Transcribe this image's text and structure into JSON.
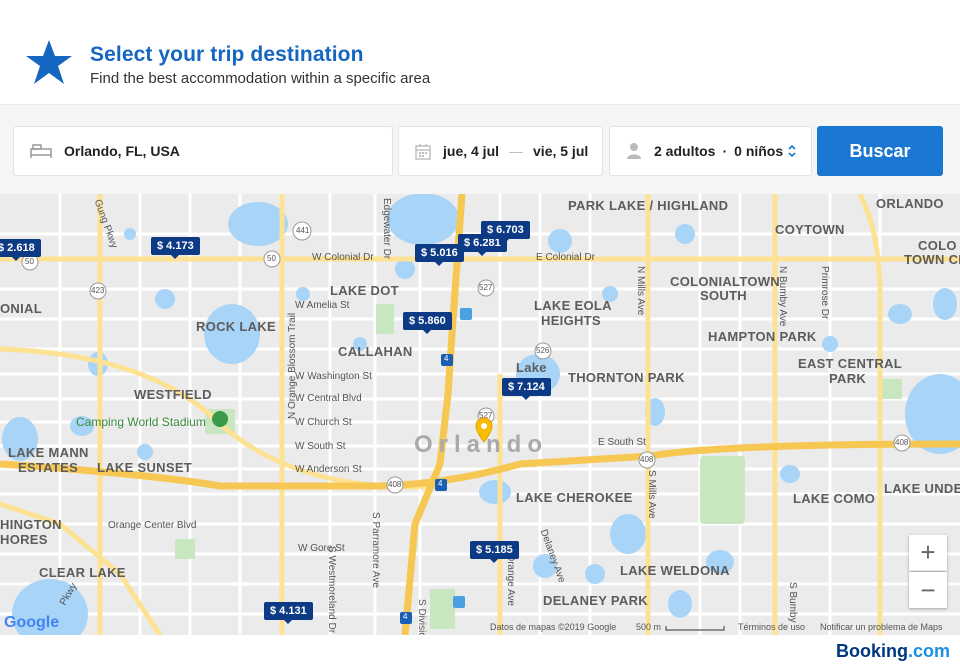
{
  "header": {
    "title": "Select your trip destination",
    "subtitle": "Find the best accommodation within a specific area",
    "icon": "star-icon",
    "accent": "#1466c1"
  },
  "search": {
    "destination": "Orlando, FL, USA",
    "checkin": "jue, 4 jul",
    "checkout": "vie, 5 jul",
    "dash": "—",
    "adults": "2 adultos",
    "children": "0 niños",
    "separator": "·",
    "button": "Buscar",
    "button_color": "#1a78d2"
  },
  "map": {
    "city": "Orlando",
    "areas": [
      "PARK LAKE / HIGHLAND",
      "ORLANDO",
      "COYTOWN",
      "COLO",
      "TOWN CE",
      "ONIAL",
      "LAKE DOT",
      "LAKE EOLA",
      "HEIGHTS",
      "COLONIALTOWN",
      "SOUTH",
      "ROCK LAKE",
      "HAMPTON PARK",
      "CALLAHAN",
      "EAST CENTRAL",
      "PARK",
      "WESTFIELD",
      "Lake",
      "THORNTON PARK",
      "LAKE MANN",
      "ESTATES",
      "LAKE SUNSET",
      "LAKE CHEROKEE",
      "LAKE COMO",
      "LAKE UNDE",
      "HINGTON",
      "HORES",
      "CLEAR LAKE",
      "LAKE WELDONA",
      "DELANEY PARK"
    ],
    "streets": [
      "W Colonial Dr",
      "E Colonial Dr",
      "W Amelia St",
      "W Washington St",
      "W Central Blvd",
      "W Church St",
      "W South St",
      "W Anderson St",
      "E South St",
      "Orange Center Blvd",
      "W Gore St",
      "N Orange Blossom Trail",
      "N Mills Ave",
      "N Bumby Ave",
      "Primrose Dr",
      "S Mills Ave",
      "S Parramore Ave",
      "S Westmoreland Dr",
      "Delaney Ave",
      "S Orange Ave",
      "S Bumby",
      "S Division",
      "Edgewater Dr",
      "Gung Pkwy",
      "Pkwy"
    ],
    "route_shields": [
      "441",
      "50",
      "50",
      "423",
      "527",
      "526",
      "4",
      "408",
      "408",
      "408",
      "4",
      "4",
      "527"
    ],
    "poi": "Camping World Stadium",
    "prices": [
      "$ 2.618",
      "$ 4.173",
      "$ 5.016",
      "$ 6.281",
      "$ 6.703",
      "$ 5.860",
      "$ 7.124",
      "$ 5.185",
      "$ 4.131"
    ],
    "zoom_in": "+",
    "zoom_out": "−",
    "google": "Google",
    "attribution": "Datos de mapas ©2019 Google",
    "scale": "500 m",
    "terms": "Términos de uso",
    "report": "Notificar un problema de Maps"
  },
  "footer": {
    "brand": "Booking",
    "brand_suffix": ".com"
  }
}
